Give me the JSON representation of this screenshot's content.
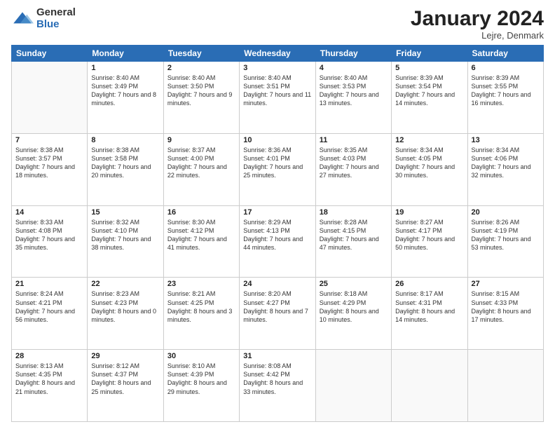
{
  "logo": {
    "general": "General",
    "blue": "Blue"
  },
  "title": "January 2024",
  "location": "Lejre, Denmark",
  "days": [
    "Sunday",
    "Monday",
    "Tuesday",
    "Wednesday",
    "Thursday",
    "Friday",
    "Saturday"
  ],
  "weeks": [
    [
      {
        "day": "",
        "sunrise": "",
        "sunset": "",
        "daylight": ""
      },
      {
        "day": "1",
        "sunrise": "Sunrise: 8:40 AM",
        "sunset": "Sunset: 3:49 PM",
        "daylight": "Daylight: 7 hours and 8 minutes."
      },
      {
        "day": "2",
        "sunrise": "Sunrise: 8:40 AM",
        "sunset": "Sunset: 3:50 PM",
        "daylight": "Daylight: 7 hours and 9 minutes."
      },
      {
        "day": "3",
        "sunrise": "Sunrise: 8:40 AM",
        "sunset": "Sunset: 3:51 PM",
        "daylight": "Daylight: 7 hours and 11 minutes."
      },
      {
        "day": "4",
        "sunrise": "Sunrise: 8:40 AM",
        "sunset": "Sunset: 3:53 PM",
        "daylight": "Daylight: 7 hours and 13 minutes."
      },
      {
        "day": "5",
        "sunrise": "Sunrise: 8:39 AM",
        "sunset": "Sunset: 3:54 PM",
        "daylight": "Daylight: 7 hours and 14 minutes."
      },
      {
        "day": "6",
        "sunrise": "Sunrise: 8:39 AM",
        "sunset": "Sunset: 3:55 PM",
        "daylight": "Daylight: 7 hours and 16 minutes."
      }
    ],
    [
      {
        "day": "7",
        "sunrise": "Sunrise: 8:38 AM",
        "sunset": "Sunset: 3:57 PM",
        "daylight": "Daylight: 7 hours and 18 minutes."
      },
      {
        "day": "8",
        "sunrise": "Sunrise: 8:38 AM",
        "sunset": "Sunset: 3:58 PM",
        "daylight": "Daylight: 7 hours and 20 minutes."
      },
      {
        "day": "9",
        "sunrise": "Sunrise: 8:37 AM",
        "sunset": "Sunset: 4:00 PM",
        "daylight": "Daylight: 7 hours and 22 minutes."
      },
      {
        "day": "10",
        "sunrise": "Sunrise: 8:36 AM",
        "sunset": "Sunset: 4:01 PM",
        "daylight": "Daylight: 7 hours and 25 minutes."
      },
      {
        "day": "11",
        "sunrise": "Sunrise: 8:35 AM",
        "sunset": "Sunset: 4:03 PM",
        "daylight": "Daylight: 7 hours and 27 minutes."
      },
      {
        "day": "12",
        "sunrise": "Sunrise: 8:34 AM",
        "sunset": "Sunset: 4:05 PM",
        "daylight": "Daylight: 7 hours and 30 minutes."
      },
      {
        "day": "13",
        "sunrise": "Sunrise: 8:34 AM",
        "sunset": "Sunset: 4:06 PM",
        "daylight": "Daylight: 7 hours and 32 minutes."
      }
    ],
    [
      {
        "day": "14",
        "sunrise": "Sunrise: 8:33 AM",
        "sunset": "Sunset: 4:08 PM",
        "daylight": "Daylight: 7 hours and 35 minutes."
      },
      {
        "day": "15",
        "sunrise": "Sunrise: 8:32 AM",
        "sunset": "Sunset: 4:10 PM",
        "daylight": "Daylight: 7 hours and 38 minutes."
      },
      {
        "day": "16",
        "sunrise": "Sunrise: 8:30 AM",
        "sunset": "Sunset: 4:12 PM",
        "daylight": "Daylight: 7 hours and 41 minutes."
      },
      {
        "day": "17",
        "sunrise": "Sunrise: 8:29 AM",
        "sunset": "Sunset: 4:13 PM",
        "daylight": "Daylight: 7 hours and 44 minutes."
      },
      {
        "day": "18",
        "sunrise": "Sunrise: 8:28 AM",
        "sunset": "Sunset: 4:15 PM",
        "daylight": "Daylight: 7 hours and 47 minutes."
      },
      {
        "day": "19",
        "sunrise": "Sunrise: 8:27 AM",
        "sunset": "Sunset: 4:17 PM",
        "daylight": "Daylight: 7 hours and 50 minutes."
      },
      {
        "day": "20",
        "sunrise": "Sunrise: 8:26 AM",
        "sunset": "Sunset: 4:19 PM",
        "daylight": "Daylight: 7 hours and 53 minutes."
      }
    ],
    [
      {
        "day": "21",
        "sunrise": "Sunrise: 8:24 AM",
        "sunset": "Sunset: 4:21 PM",
        "daylight": "Daylight: 7 hours and 56 minutes."
      },
      {
        "day": "22",
        "sunrise": "Sunrise: 8:23 AM",
        "sunset": "Sunset: 4:23 PM",
        "daylight": "Daylight: 8 hours and 0 minutes."
      },
      {
        "day": "23",
        "sunrise": "Sunrise: 8:21 AM",
        "sunset": "Sunset: 4:25 PM",
        "daylight": "Daylight: 8 hours and 3 minutes."
      },
      {
        "day": "24",
        "sunrise": "Sunrise: 8:20 AM",
        "sunset": "Sunset: 4:27 PM",
        "daylight": "Daylight: 8 hours and 7 minutes."
      },
      {
        "day": "25",
        "sunrise": "Sunrise: 8:18 AM",
        "sunset": "Sunset: 4:29 PM",
        "daylight": "Daylight: 8 hours and 10 minutes."
      },
      {
        "day": "26",
        "sunrise": "Sunrise: 8:17 AM",
        "sunset": "Sunset: 4:31 PM",
        "daylight": "Daylight: 8 hours and 14 minutes."
      },
      {
        "day": "27",
        "sunrise": "Sunrise: 8:15 AM",
        "sunset": "Sunset: 4:33 PM",
        "daylight": "Daylight: 8 hours and 17 minutes."
      }
    ],
    [
      {
        "day": "28",
        "sunrise": "Sunrise: 8:13 AM",
        "sunset": "Sunset: 4:35 PM",
        "daylight": "Daylight: 8 hours and 21 minutes."
      },
      {
        "day": "29",
        "sunrise": "Sunrise: 8:12 AM",
        "sunset": "Sunset: 4:37 PM",
        "daylight": "Daylight: 8 hours and 25 minutes."
      },
      {
        "day": "30",
        "sunrise": "Sunrise: 8:10 AM",
        "sunset": "Sunset: 4:39 PM",
        "daylight": "Daylight: 8 hours and 29 minutes."
      },
      {
        "day": "31",
        "sunrise": "Sunrise: 8:08 AM",
        "sunset": "Sunset: 4:42 PM",
        "daylight": "Daylight: 8 hours and 33 minutes."
      },
      {
        "day": "",
        "sunrise": "",
        "sunset": "",
        "daylight": ""
      },
      {
        "day": "",
        "sunrise": "",
        "sunset": "",
        "daylight": ""
      },
      {
        "day": "",
        "sunrise": "",
        "sunset": "",
        "daylight": ""
      }
    ]
  ]
}
